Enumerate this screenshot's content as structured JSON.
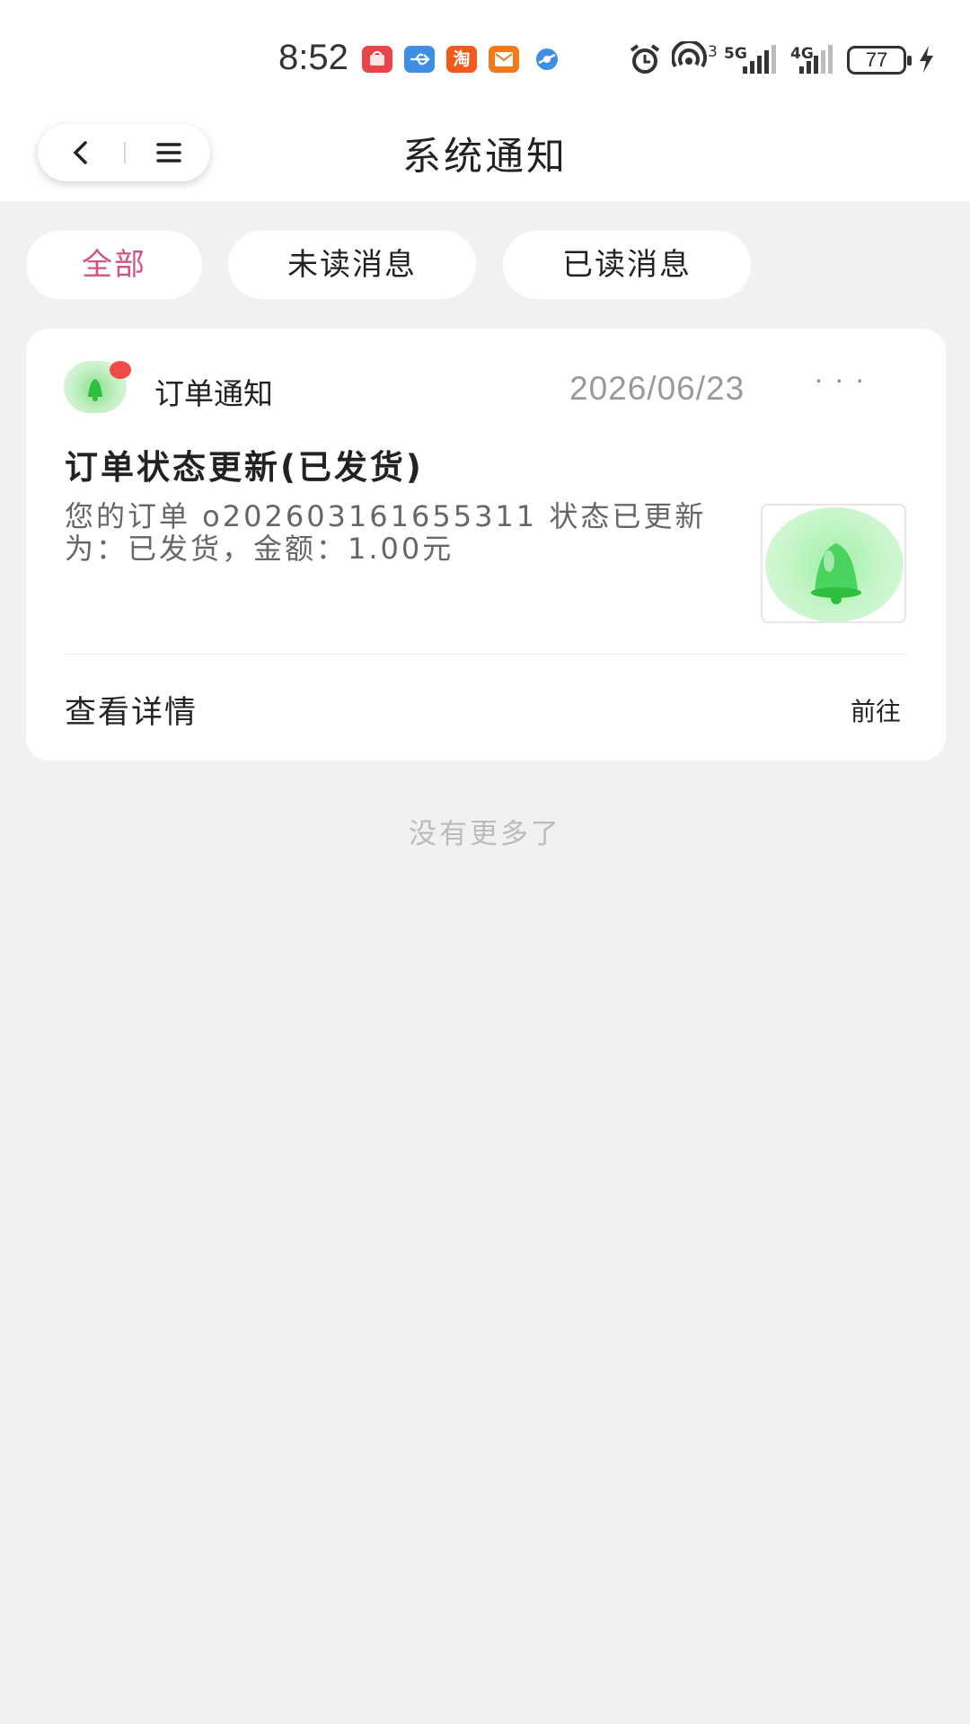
{
  "status_bar": {
    "time": "8:52",
    "app_icons": [
      {
        "name": "huawei-store-icon",
        "color": "#e8454a"
      },
      {
        "name": "usb-icon",
        "color": "#3f8ee6"
      },
      {
        "name": "taobao-icon",
        "color": "#f05a1a"
      },
      {
        "name": "mail-app-icon",
        "color": "#f27a1a"
      },
      {
        "name": "browser-icon",
        "color": "#3f8ee6"
      }
    ],
    "hotspot_count": "3",
    "network_5g": "5G",
    "network_4g": "4G",
    "battery": "77"
  },
  "header": {
    "title": "系统通知",
    "back_icon": "chevron-left-icon",
    "menu_icon": "hamburger-menu-icon"
  },
  "tabs": [
    {
      "label": "全部",
      "active": true
    },
    {
      "label": "未读消息",
      "active": false
    },
    {
      "label": "已读消息",
      "active": false
    }
  ],
  "notification": {
    "category": "订单通知",
    "date": "2026/06/23",
    "more": "···",
    "title": "订单状态更新(已发货)",
    "body": "您的订单 o202603161655311 状态已更新为：已发货，金额：1.00元",
    "unread": true,
    "action_label": "查看详情",
    "action_link": "前往"
  },
  "footer": {
    "no_more": "没有更多了"
  },
  "colors": {
    "accent": "#d4537e",
    "unread_dot": "#f04b4b",
    "background": "#f1f1f1"
  }
}
